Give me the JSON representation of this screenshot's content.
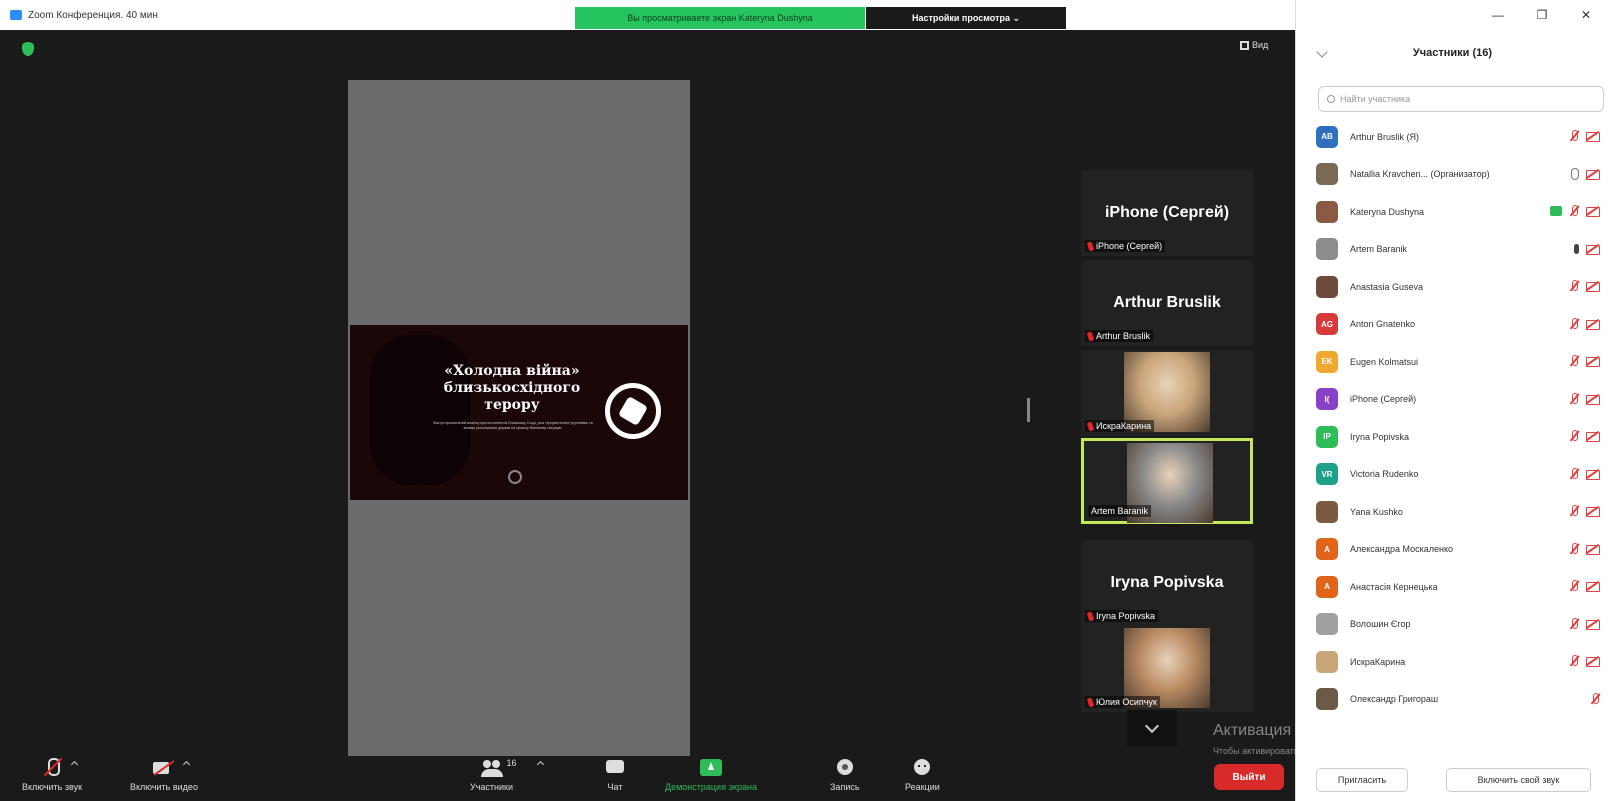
{
  "window": {
    "title": "Zoom Конференция. 40 мин",
    "viewing_banner": "Вы просматриваете экран Kateryna Dushyna",
    "view_options": "Настройки просмотра ⌄",
    "view_button": "Вид"
  },
  "slide": {
    "heading_line1": "«Холодна війна»",
    "heading_line2": "близькосхідного",
    "heading_line3": "терору",
    "body": "Виступ присвячений аналізу протистояння на Близькому Сході, ролі терористичних угруповань та впливу регіональних держав на сучасну безпекову ситуацію."
  },
  "gallery": [
    {
      "big_name": "iPhone (Сергей)",
      "footer": "iPhone (Сергей)",
      "muted": true,
      "type": "name"
    },
    {
      "big_name": "Arthur Bruslik",
      "footer": "Arthur Bruslik",
      "muted": true,
      "type": "name"
    },
    {
      "big_name": "",
      "footer": "ИскраКарина",
      "muted": true,
      "type": "photo",
      "photo_color": "#c9a57a"
    },
    {
      "big_name": "",
      "footer": "Artem Baranik",
      "muted": false,
      "type": "photo",
      "photo_color": "#8a8a8a",
      "active": true
    },
    {
      "big_name": "Iryna Popivska",
      "footer": "Iryna Popivska",
      "muted": true,
      "type": "name"
    },
    {
      "big_name": "",
      "footer": "Юлия Осипчук",
      "muted": true,
      "type": "photo",
      "photo_color": "#b98b62"
    }
  ],
  "watermark": {
    "line1": "Активация Windows",
    "line2": "Чтобы активировать Windows, перейдите в раздел \"Параметры\"."
  },
  "toolbar": {
    "unmute": "Включить звук",
    "start_video": "Включить видео",
    "participants": "Участники",
    "participants_count": "16",
    "chat": "Чат",
    "share": "Демонстрация экрана",
    "record": "Запись",
    "reactions": "Реакции",
    "leave": "Выйти"
  },
  "panel": {
    "title": "Участники (16)",
    "search_placeholder": "Найти участника",
    "invite": "Пригласить",
    "unmute_me": "Включить свой звук",
    "participants": [
      {
        "initials": "AB",
        "color": "#2f6fbf",
        "name": "Arthur Bruslik (Я)",
        "icons": [
          "mic-muted",
          "cam-muted"
        ]
      },
      {
        "initials": "",
        "color": "#7a6a55",
        "name": "Natallia Kravchen...  (Организатор)",
        "icons": [
          "mic-on",
          "cam-muted"
        ]
      },
      {
        "initials": "",
        "color": "#8a5a44",
        "name": "Kateryna Dushyna",
        "icons": [
          "share",
          "mic-muted",
          "cam-muted"
        ]
      },
      {
        "initials": "",
        "color": "#8c8c8c",
        "name": "Artem Baranik",
        "icons": [
          "mic-dark",
          "cam-muted"
        ]
      },
      {
        "initials": "",
        "color": "#6e4a3a",
        "name": "Anastasia Guseva",
        "icons": [
          "mic-muted",
          "cam-muted"
        ]
      },
      {
        "initials": "AG",
        "color": "#d63a3a",
        "name": "Anton Gnatenko",
        "icons": [
          "mic-muted",
          "cam-muted"
        ]
      },
      {
        "initials": "EK",
        "color": "#f0a830",
        "name": "Eugen Kolmatsui",
        "icons": [
          "mic-muted",
          "cam-muted"
        ]
      },
      {
        "initials": "I(",
        "color": "#8a3fc7",
        "name": "iPhone (Сергей)",
        "icons": [
          "mic-muted",
          "cam-muted"
        ]
      },
      {
        "initials": "IP",
        "color": "#2ebd59",
        "name": "Iryna Popivska",
        "icons": [
          "mic-muted",
          "cam-muted"
        ]
      },
      {
        "initials": "VR",
        "color": "#1fa08a",
        "name": "Victoria Rudenko",
        "icons": [
          "mic-muted",
          "cam-muted"
        ]
      },
      {
        "initials": "",
        "color": "#7a5a40",
        "name": "Yana Kushko",
        "icons": [
          "mic-muted",
          "cam-muted"
        ]
      },
      {
        "initials": "A",
        "color": "#e0641a",
        "name": "Александра Москаленко",
        "icons": [
          "mic-muted",
          "cam-muted"
        ]
      },
      {
        "initials": "A",
        "color": "#e0641a",
        "name": "Анастасія Кернецька",
        "icons": [
          "mic-muted",
          "cam-muted"
        ]
      },
      {
        "initials": "",
        "color": "#a0a0a0",
        "name": "Волошин Єгор",
        "icons": [
          "mic-muted",
          "cam-muted"
        ]
      },
      {
        "initials": "",
        "color": "#c9a57a",
        "name": "ИскраКарина",
        "icons": [
          "mic-muted",
          "cam-muted"
        ]
      },
      {
        "initials": "",
        "color": "#6b5a48",
        "name": "Олександр Григораш",
        "icons": [
          "mic-muted"
        ]
      }
    ]
  }
}
